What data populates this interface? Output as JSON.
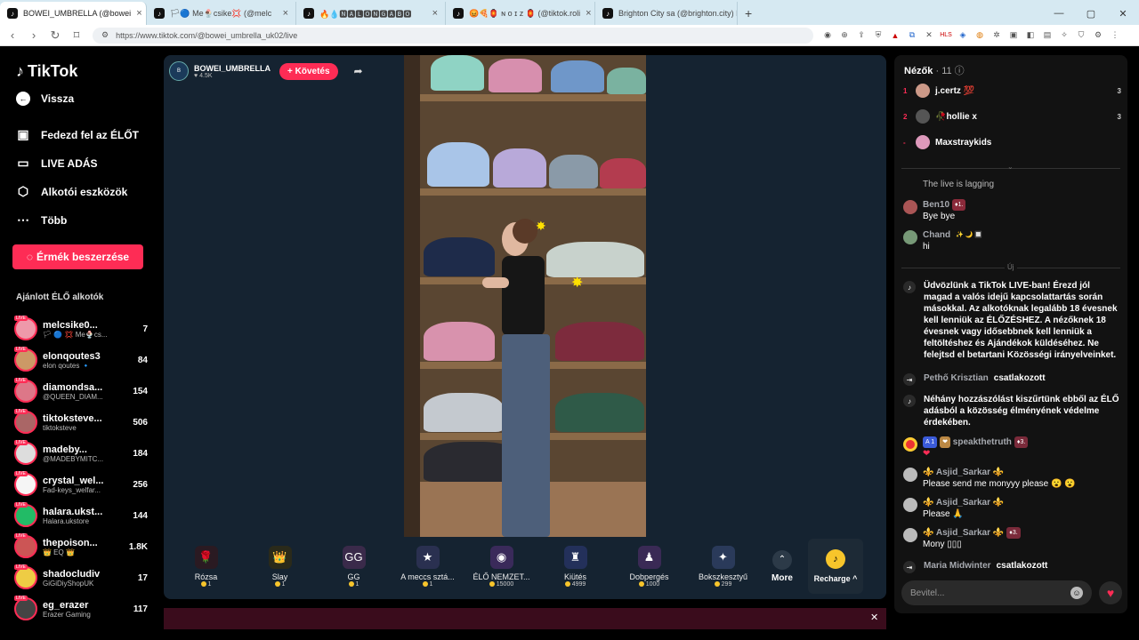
{
  "browser": {
    "tabs": [
      {
        "icon": "♪",
        "label": "BOWEI_UMBRELLA (@bowei",
        "active": true
      },
      {
        "icon": "♪",
        "label": "🏳🔵 Me🍨csike💢 (@melc",
        "active": false
      },
      {
        "icon": "♪",
        "label": "🔥💧🅽🅰🅻🅾🅽🅶🅰🅱🅾",
        "active": false
      },
      {
        "icon": "♪",
        "label": "😡🍕🏮 ɴ ᴏ ɪ ᴢ 🏮 (@tiktok.roli",
        "active": false
      },
      {
        "icon": "♪",
        "label": "Brighton City sa (@brighton.city) ÉLŐ",
        "active": false
      }
    ],
    "url": "https://www.tiktok.com/@bowei_umbrella_uk02/live"
  },
  "sidebar": {
    "logo": "TikTok",
    "back": "Vissza",
    "menu": [
      {
        "icon": "▣",
        "label": "Fedezd fel az ÉLŐT"
      },
      {
        "icon": "▭",
        "label": "LIVE ADÁS"
      },
      {
        "icon": "⬡",
        "label": "Alkotói eszközök"
      },
      {
        "icon": "⋯",
        "label": "Több"
      }
    ],
    "coins_button": "Érmék beszerzése",
    "recommended_heading": "Ajánlott ÉLŐ alkotók",
    "live_badge": "LIVE",
    "creators": [
      {
        "name": "melcsike0...",
        "sub": "🏳 🔵 💢 Me🍨cs...",
        "count": "7",
        "color": "#e9a"
      },
      {
        "name": "elonqoutes3",
        "sub": "elon qoutes 🔹",
        "count": "84",
        "color": "#c96"
      },
      {
        "name": "diamondsa...",
        "sub": "@QUEEN_DIAM...",
        "count": "154",
        "color": "#d78"
      },
      {
        "name": "tiktoksteve...",
        "sub": "tiktoksteve",
        "count": "506",
        "color": "#a66"
      },
      {
        "name": "madeby...",
        "sub": "@MADEBYMITC...",
        "count": "184",
        "color": "#ddd"
      },
      {
        "name": "crystal_wel...",
        "sub": "Fad-keys_welfar...",
        "count": "256",
        "color": "#f5f5f5"
      },
      {
        "name": "halara.ukst...",
        "sub": "Halara.ukstore",
        "count": "144",
        "color": "#2b6"
      },
      {
        "name": "thepoison...",
        "sub": "👑 EQ 👑",
        "count": "1.8K",
        "color": "#c55"
      },
      {
        "name": "shadocludiv",
        "sub": "GiGiDiyShopUK",
        "count": "17",
        "color": "#ec4"
      },
      {
        "name": "eg_erazer",
        "sub": "Erazer Gaming",
        "count": "117",
        "color": "#444"
      }
    ]
  },
  "stream": {
    "host_name": "BOWEI_UMBRELLA",
    "host_likes": "♥ 4.5K",
    "follow": "+ Követés",
    "gifts": [
      {
        "name": "Rózsa",
        "price": "1",
        "icon": "🌹",
        "bg": "#2a1a22"
      },
      {
        "name": "Slay",
        "price": "1",
        "icon": "👑",
        "bg": "#2a2a1a"
      },
      {
        "name": "GG",
        "price": "1",
        "icon": "GG",
        "bg": "#3a2a4a"
      },
      {
        "name": "A meccs sztá...",
        "price": "1",
        "icon": "★",
        "bg": "#2a3050"
      },
      {
        "name": "ÉLŐ NEMZET...",
        "price": "15000",
        "icon": "◉",
        "bg": "#3a2a5a"
      },
      {
        "name": "Kiütés",
        "price": "4999",
        "icon": "♜",
        "bg": "#23305a"
      },
      {
        "name": "Dobpergés",
        "price": "1000",
        "icon": "♟",
        "bg": "#3a2a55"
      },
      {
        "name": "Bokszkesztyű",
        "price": "299",
        "icon": "✦",
        "bg": "#2a3a5a"
      }
    ],
    "more": "More",
    "recharge": "Recharge ^"
  },
  "chat": {
    "viewers_label": "Nézők",
    "viewers_count": "· 11",
    "top_viewers": [
      {
        "rank": "1",
        "name": "j.certz 💯",
        "count": "3",
        "color": "#c98"
      },
      {
        "rank": "2",
        "name": "🥀hollie x",
        "count": "3",
        "color": "#555"
      },
      {
        "rank": "-",
        "name": "Maxstraykids",
        "count": "",
        "color": "#d9b"
      }
    ],
    "messages": [
      {
        "type": "plain",
        "user": "",
        "text": "The live is lagging",
        "color": "#555"
      },
      {
        "type": "user",
        "user": "Ben10",
        "badge": "♦1.",
        "badge_bg": "#8a2a3a",
        "text": "Bye bye",
        "color": "#a55"
      },
      {
        "type": "user",
        "user": "Chand",
        "badge": "✨ 🌙 🔲",
        "badge_bg": "transparent",
        "text": "hi",
        "color": "#797"
      }
    ],
    "new_label": "Új",
    "system_welcome": "Üdvözlünk a TikTok LIVE-ban! Érezd jól magad a valós idejű kapcsolattartás során másokkal. Az alkotóknak legalább 18 évesnek kell lenniük az ÉLŐZÉSHEZ. A nézőknek 18 évesnek vagy idősebbnek kell lenniük a feltöltéshez és Ajándékok küldéséhez. Ne felejtsd el betartani Közösségi irányelveinket.",
    "join1_user": "Pethő Krisztian",
    "joined": "csatlakozott",
    "system_filter": "Néhány hozzászólást kiszűrtünk ebből az ÉLŐ adásból a közösség élményének védelme érdekében.",
    "speak": {
      "badge1": "A 1",
      "user": "speakthetruth",
      "badge2": "♦3.",
      "text": "❤"
    },
    "asjid": [
      {
        "user": "⚜️ Asjid_Sarkar ⚜️",
        "badge": "",
        "text": "Please send me monyyy please 😮 😮"
      },
      {
        "user": "⚜️ Asjid_Sarkar ⚜️",
        "badge": "",
        "text": "Please 🙏"
      },
      {
        "user": "⚜️ Asjid_Sarkar ⚜️",
        "badge": "♦3.",
        "text": "Mony ▯▯▯"
      }
    ],
    "join2_user": "Maria Midwinter",
    "input_placeholder": "Bevitel..."
  }
}
